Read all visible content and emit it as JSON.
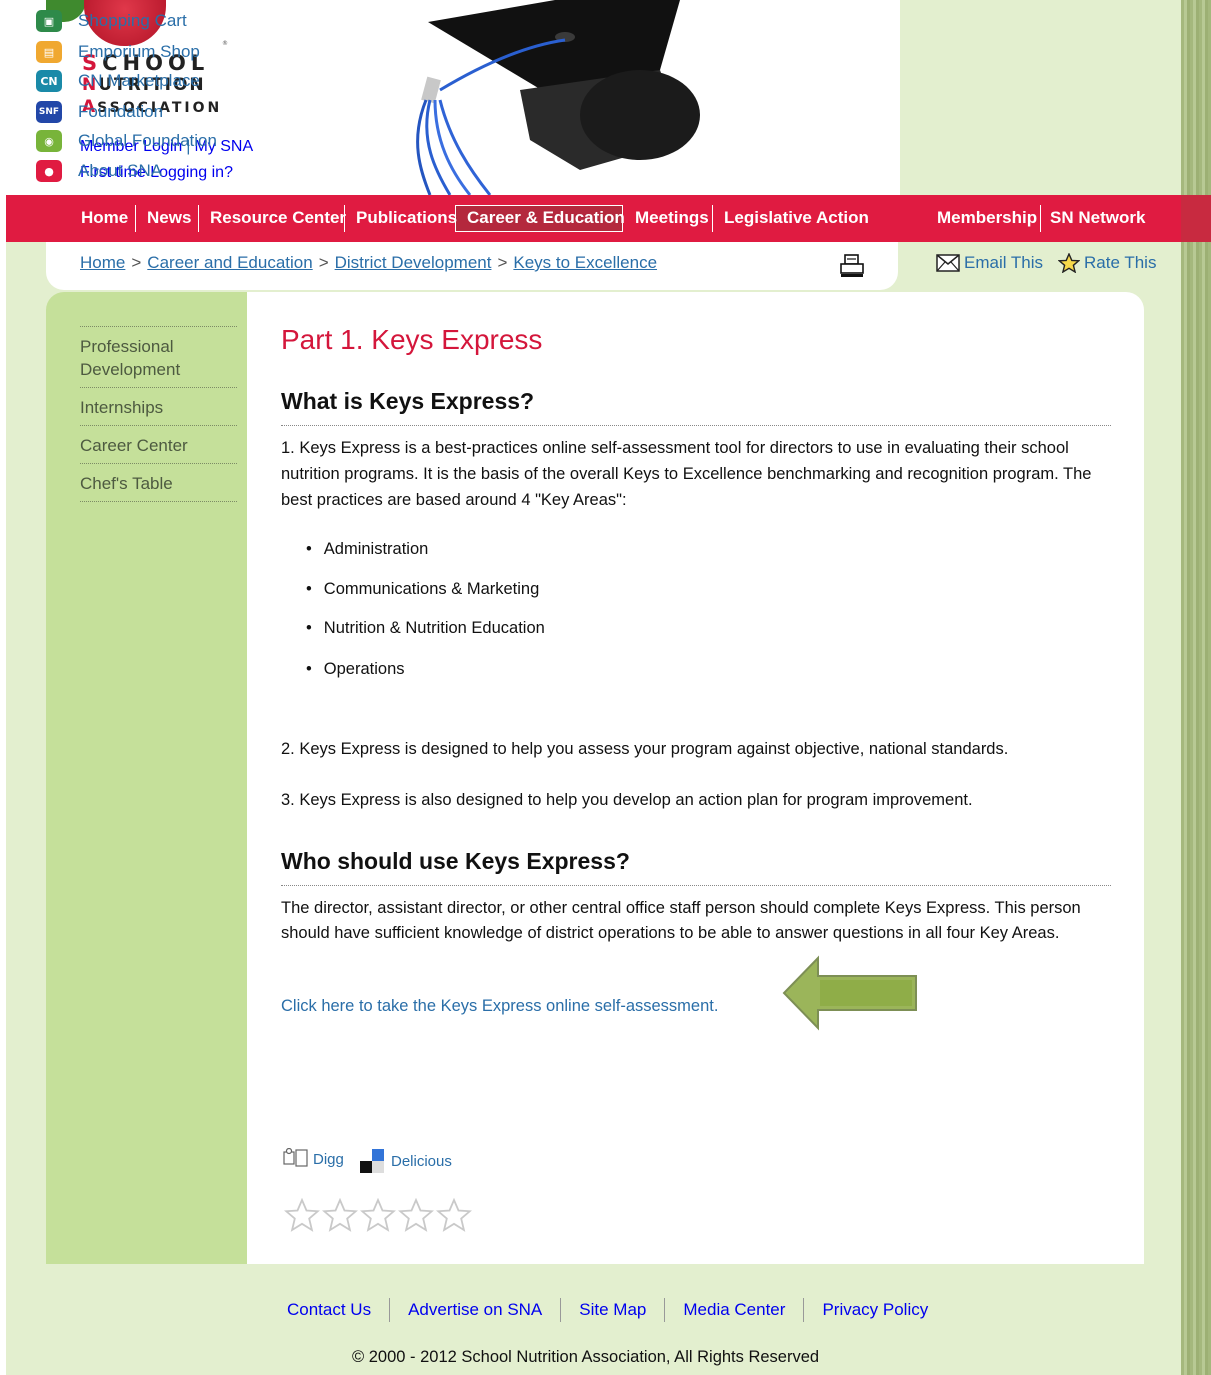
{
  "logo": {
    "line1": "SCHOOL",
    "line2": "NUTRITION",
    "line3": "ASSOCIATION",
    "registered": "®"
  },
  "member": {
    "login": "Member Login",
    "separator": "|",
    "my_sna": "My SNA",
    "first_time": "First time Logging in?"
  },
  "quick_links": [
    {
      "label": "Shopping Cart",
      "icon": "shopping-cart-icon",
      "color": "#2e8a4a",
      "glyph": "🛒"
    },
    {
      "label": "Emporium Shop",
      "icon": "emporium-shop-icon",
      "color": "#f0a830",
      "glyph": "▤"
    },
    {
      "label": "CN Marketplace",
      "icon": "cn-marketplace-icon",
      "color": "#1a8aa8",
      "glyph": "CN"
    },
    {
      "label": "Foundation",
      "icon": "snf-foundation-icon",
      "color": "#2247a8",
      "glyph": "SNF"
    },
    {
      "label": "Global Foundation",
      "icon": "globe-icon",
      "color": "#78b43a",
      "glyph": "🌐"
    },
    {
      "label": "About SNA",
      "icon": "apple-icon",
      "color": "#e01b41",
      "glyph": "●"
    }
  ],
  "nav": {
    "items": [
      "Home",
      "News",
      "Resource Center",
      "Publications",
      "Career & Education",
      "Meetings",
      "Legislative Action"
    ],
    "right_items": [
      "Membership",
      "SN Network"
    ],
    "active": "Career & Education"
  },
  "breadcrumb": {
    "items": [
      "Home",
      "Career and Education",
      "District Development",
      "Keys to Excellence"
    ],
    "separator": ">"
  },
  "tools": {
    "email": "Email This",
    "rate": "Rate This"
  },
  "sidebar": {
    "items": [
      "Professional Development",
      "Internships",
      "Career Center",
      "Chef's Table"
    ]
  },
  "content": {
    "title": "Part 1. Keys Express",
    "h_what": "What is Keys Express?",
    "p1": "1. Keys Express is a best-practices online self-assessment tool for directors to use in evaluating their school nutrition programs. It is the basis of the overall Keys to Excellence benchmarking and recognition program. The best practices are based around 4 \"Key Areas\":",
    "key_areas": [
      "Administration",
      "Communications & Marketing",
      "Nutrition & Nutrition Education",
      "Operations"
    ],
    "p2": "2. Keys Express is designed to help you assess your program against objective, national standards.",
    "p3": "3. Keys Express is also designed to help you develop an action plan for program improvement.",
    "h_who": "Who should use Keys Express?",
    "p4": "The director, assistant director, or other central office staff person should complete Keys Express. This person should have sufficient knowledge of district operations to be able to answer questions in all four Key Areas.",
    "cta": "Click here to take the Keys Express online self-assessment."
  },
  "social": {
    "digg": "Digg",
    "delicious": "Delicious",
    "rating_stars": 0,
    "rating_max": 5
  },
  "footer": {
    "links": [
      "Contact Us",
      "Advertise on SNA",
      "Site Map",
      "Media Center",
      "Privacy Policy"
    ],
    "copyright": "© 2000 - 2012 School Nutrition Association, All Rights Reserved"
  }
}
